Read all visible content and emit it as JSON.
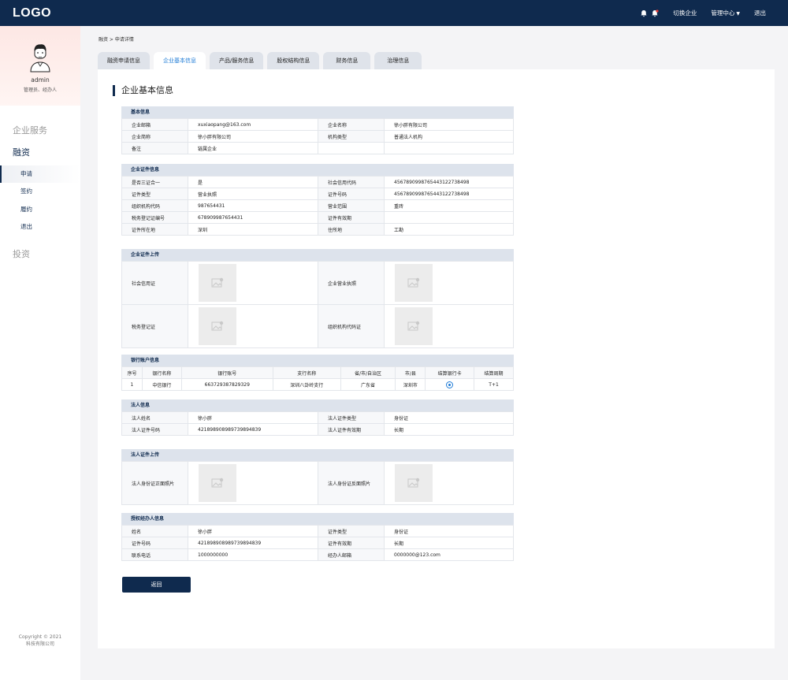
{
  "header": {
    "logo": "LOGO",
    "switch_company": "切换企业",
    "admin_center": "管理中心",
    "logout": "退出"
  },
  "sidebar": {
    "username": "admin",
    "role": "管理员、经办人",
    "groups": [
      "企业服务",
      "融资",
      "投资"
    ],
    "items": [
      "申请",
      "签约",
      "履约",
      "退出"
    ],
    "copyright_line1": "Copyright © 2021",
    "copyright_line2": "科技有限公司"
  },
  "breadcrumb": "融资 > 申请详情",
  "tabs": [
    "融资申请信息",
    "企业基本信息",
    "产品/服务信息",
    "股权结构信息",
    "财务信息",
    "治理信息"
  ],
  "page_title": "企业基本信息",
  "basic": {
    "title": "基本信息",
    "rows": [
      [
        "企业邮箱",
        "xuxiaopang@163.com",
        "企业名称",
        "徐小胖有限公司"
      ],
      [
        "企业简称",
        "徐小胖有限公司",
        "机构类型",
        "普通法人机构"
      ],
      [
        "备注",
        "链属企业",
        "",
        ""
      ]
    ]
  },
  "cert": {
    "title": "企业证件信息",
    "rows": [
      [
        "是否三证合一",
        "是",
        "社会信用代码",
        "45678909987654431227384​98"
      ],
      [
        "证件类型",
        "营业执照",
        "证件号码",
        "456789099876544312273849​8"
      ],
      [
        "组织机构代码",
        "987654431",
        "营业范围",
        "重砖"
      ],
      [
        "税务登记证编号",
        "678909987654431",
        "证件有效期",
        ""
      ],
      [
        "证件所在地",
        "深圳",
        "住所地",
        "工勘"
      ]
    ]
  },
  "cert_upload": {
    "title": "企业证件上传",
    "rows": [
      [
        "社会信用证",
        "企业营业执照"
      ],
      [
        "税务登记证",
        "组织机构代码证"
      ]
    ]
  },
  "bank": {
    "title": "银行账户信息",
    "headers": [
      "序号",
      "银行名称",
      "银行账号",
      "支行名称",
      "省/市/自治区",
      "市/县",
      "结算银行卡",
      "结算周期"
    ],
    "row": [
      "1",
      "中信银行",
      "663729387829329",
      "深圳八卦岭支行",
      "广东省",
      "深圳市",
      "",
      "T+1"
    ]
  },
  "legal": {
    "title": "法人信息",
    "rows": [
      [
        "法人姓名",
        "徐小胖",
        "法人证件类型",
        "身份证"
      ],
      [
        "法人证件号码",
        "421898908989739894839",
        "法人证件有效期",
        "长期"
      ]
    ]
  },
  "legal_upload": {
    "title": "法人证件上传",
    "row": [
      "法人身份证正面照片",
      "法人身份证反面照片"
    ]
  },
  "agent": {
    "title": "授权经办人信息",
    "rows": [
      [
        "姓名",
        "徐小胖",
        "证件类型",
        "身份证"
      ],
      [
        "证件号码",
        "421898908989739894839",
        "证件有效期",
        "长期"
      ],
      [
        "联系电话",
        "1000000000",
        "经办人邮箱",
        "0000000@123.com"
      ]
    ]
  },
  "back_button": "返回"
}
